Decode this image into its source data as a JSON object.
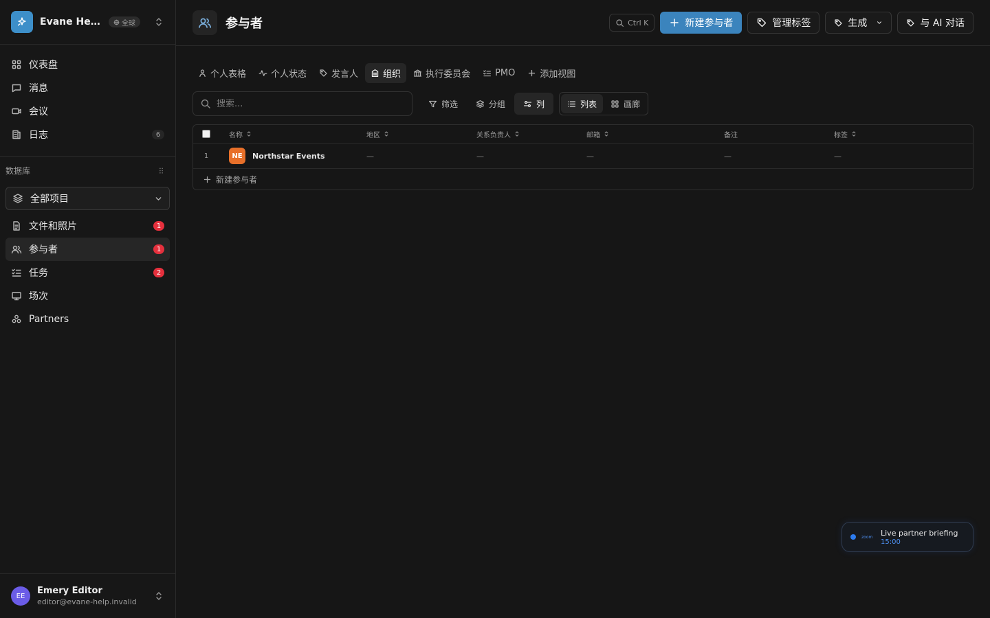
{
  "workspace": {
    "name": "Evane Help ...",
    "badge": "全球"
  },
  "nav": {
    "items": [
      {
        "label": "仪表盘",
        "icon": "dashboard-icon"
      },
      {
        "label": "消息",
        "icon": "message-icon"
      },
      {
        "label": "会议",
        "icon": "video-icon"
      },
      {
        "label": "日志",
        "icon": "log-icon",
        "count": "6"
      }
    ]
  },
  "database": {
    "title": "数据库",
    "select": "全部项目",
    "items": [
      {
        "label": "文件和照片",
        "icon": "file-icon",
        "count": "1"
      },
      {
        "label": "参与者",
        "icon": "users-icon",
        "count": "1",
        "active": true
      },
      {
        "label": "任务",
        "icon": "tasks-icon",
        "count": "2"
      },
      {
        "label": "场次",
        "icon": "presentation-icon"
      },
      {
        "label": "Partners",
        "icon": "partners-icon"
      }
    ]
  },
  "user": {
    "initials": "EE",
    "name": "Emery Editor",
    "email": "editor@evane-help.invalid"
  },
  "header": {
    "title": "参与者",
    "shortcut": "Ctrl K",
    "new_button": "新建参与者",
    "manage_tags": "管理标签",
    "generate": "生成",
    "ai_chat": "与 AI 对话"
  },
  "views": [
    {
      "label": "个人表格",
      "icon": "person-icon"
    },
    {
      "label": "个人状态",
      "icon": "activity-icon"
    },
    {
      "label": "发言人",
      "icon": "tag-icon"
    },
    {
      "label": "组织",
      "icon": "building-icon",
      "active": true
    },
    {
      "label": "执行委员会",
      "icon": "bank-icon"
    },
    {
      "label": "PMO",
      "icon": "checklist-icon"
    },
    {
      "label": "添加视图",
      "icon": "plus-icon"
    }
  ],
  "toolbar": {
    "search_placeholder": "搜索...",
    "filter": "筛选",
    "group": "分组",
    "columns": "列",
    "list": "列表",
    "gallery": "画廊"
  },
  "table": {
    "columns": [
      "名称",
      "地区",
      "关系负责人",
      "邮箱",
      "备注",
      "标签"
    ],
    "rows": [
      {
        "num": "1",
        "initials": "NE",
        "name": "Northstar Events",
        "region": "—",
        "owner": "—",
        "email": "—",
        "notes": "—",
        "tags": "—"
      }
    ],
    "add_row": "新建参与者"
  },
  "toast": {
    "title": "Live partner briefing",
    "time": "15:00",
    "app": "zoom"
  },
  "colors": {
    "accent": "#3b84bd",
    "badge_red": "#e5303d",
    "org_avatar": "#e8702a",
    "user_avatar": "#6b5ce7"
  }
}
